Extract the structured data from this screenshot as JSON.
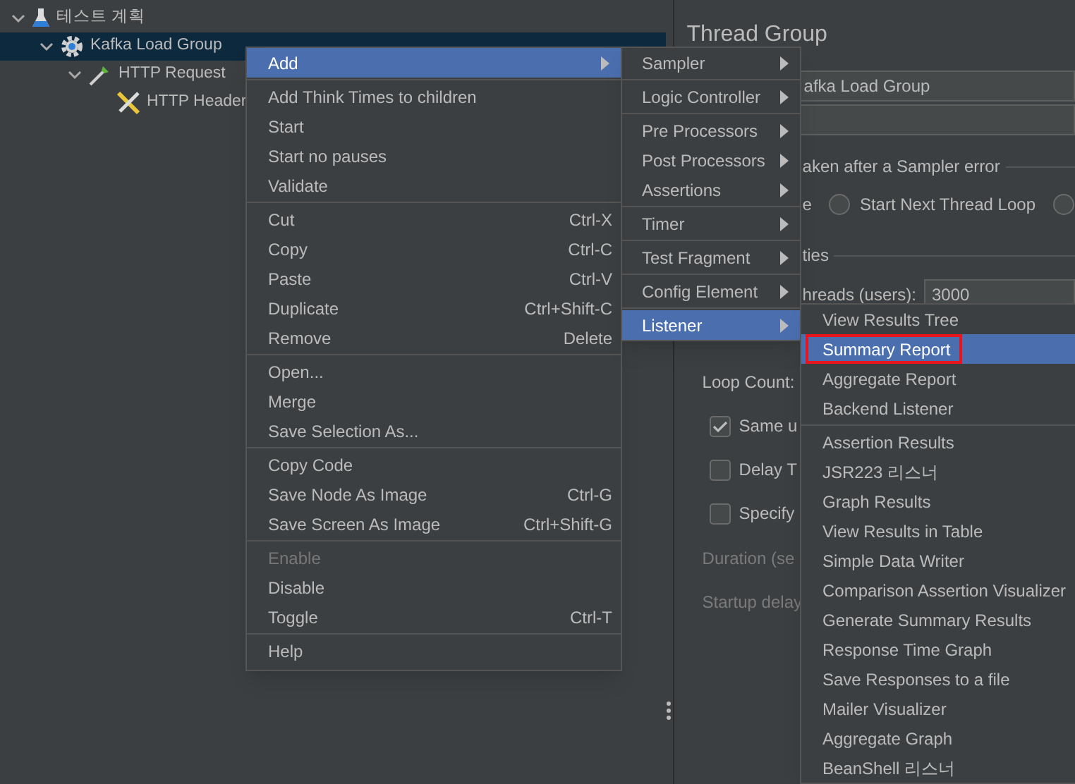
{
  "tree": {
    "items": [
      {
        "label": "테스트 계획",
        "expanded": true,
        "selected": false,
        "kind": "flask",
        "children": [
          {
            "label": "Kafka Load Group",
            "expanded": true,
            "selected": true,
            "kind": "gear",
            "children": [
              {
                "label": "HTTP Request",
                "expanded": true,
                "selected": false,
                "kind": "dropper",
                "children": [
                  {
                    "label": "HTTP Header",
                    "selected": false,
                    "kind": "tools"
                  }
                ]
              }
            ]
          }
        ]
      }
    ]
  },
  "panel": {
    "title": "Thread Group",
    "name_value": "afka Load Group",
    "error_legend": "aken after a Sampler error",
    "error_fragment": "e",
    "error_options": [
      {
        "label": "Start Next Thread Loop",
        "selected": false
      },
      {
        "selected": false
      }
    ],
    "properties_legend": "ties",
    "threads_label": "hreads (users):",
    "threads_value": "3000",
    "loop_label": "Loop Count:",
    "checks": [
      {
        "label": "Same u",
        "checked": true
      },
      {
        "label": "Delay T",
        "checked": false
      },
      {
        "label": "Specify",
        "checked": false
      }
    ],
    "disabled_labels": [
      "Duration (se",
      "Startup delay"
    ]
  },
  "context_menu": {
    "groups": [
      [
        {
          "label": "Add",
          "selected": true,
          "disabled": false,
          "submenu": true
        }
      ],
      [
        {
          "label": "Add Think Times to children",
          "selected": false,
          "disabled": false,
          "submenu": false
        },
        {
          "label": "Start",
          "selected": false,
          "disabled": false,
          "submenu": false
        },
        {
          "label": "Start no pauses",
          "selected": false,
          "disabled": false,
          "submenu": false
        },
        {
          "label": "Validate",
          "selected": false,
          "disabled": false,
          "submenu": false
        }
      ],
      [
        {
          "label": "Cut",
          "shortcut": "Ctrl-X",
          "selected": false,
          "disabled": false,
          "submenu": false
        },
        {
          "label": "Copy",
          "shortcut": "Ctrl-C",
          "selected": false,
          "disabled": false,
          "submenu": false
        },
        {
          "label": "Paste",
          "shortcut": "Ctrl-V",
          "selected": false,
          "disabled": false,
          "submenu": false
        },
        {
          "label": "Duplicate",
          "shortcut": "Ctrl+Shift-C",
          "selected": false,
          "disabled": false,
          "submenu": false
        },
        {
          "label": "Remove",
          "shortcut": "Delete",
          "selected": false,
          "disabled": false,
          "submenu": false
        }
      ],
      [
        {
          "label": "Open...",
          "selected": false,
          "disabled": false,
          "submenu": false
        },
        {
          "label": "Merge",
          "selected": false,
          "disabled": false,
          "submenu": false
        },
        {
          "label": "Save Selection As...",
          "selected": false,
          "disabled": false,
          "submenu": false
        }
      ],
      [
        {
          "label": "Copy Code",
          "selected": false,
          "disabled": false,
          "submenu": false
        },
        {
          "label": "Save Node As Image",
          "shortcut": "Ctrl-G",
          "selected": false,
          "disabled": false,
          "submenu": false
        },
        {
          "label": "Save Screen As Image",
          "shortcut": "Ctrl+Shift-G",
          "selected": false,
          "disabled": false,
          "submenu": false
        }
      ],
      [
        {
          "label": "Enable",
          "selected": false,
          "disabled": true,
          "submenu": false
        },
        {
          "label": "Disable",
          "selected": false,
          "disabled": false,
          "submenu": false
        },
        {
          "label": "Toggle",
          "shortcut": "Ctrl-T",
          "selected": false,
          "disabled": false,
          "submenu": false
        }
      ],
      [
        {
          "label": "Help",
          "selected": false,
          "disabled": false,
          "submenu": false
        }
      ]
    ]
  },
  "add_menu": {
    "groups": [
      [
        {
          "label": "Sampler",
          "selected": false
        }
      ],
      [
        {
          "label": "Logic Controller",
          "selected": false
        }
      ],
      [
        {
          "label": "Pre Processors",
          "selected": false
        },
        {
          "label": "Post Processors",
          "selected": false
        },
        {
          "label": "Assertions",
          "selected": false
        }
      ],
      [
        {
          "label": "Timer",
          "selected": false
        }
      ],
      [
        {
          "label": "Test Fragment",
          "selected": false
        }
      ],
      [
        {
          "label": "Config Element",
          "selected": false
        }
      ],
      [
        {
          "label": "Listener",
          "selected": true
        }
      ]
    ]
  },
  "listener_menu": {
    "groups": [
      [
        {
          "label": "View Results Tree",
          "selected": false,
          "outlined": false
        },
        {
          "label": "Summary Report",
          "selected": true,
          "outlined": true
        },
        {
          "label": "Aggregate Report",
          "selected": false,
          "outlined": false
        },
        {
          "label": "Backend Listener",
          "selected": false,
          "outlined": false
        }
      ],
      [
        {
          "label": "Assertion Results",
          "selected": false,
          "outlined": false
        },
        {
          "label": "JSR223 리스너",
          "selected": false,
          "outlined": false
        },
        {
          "label": "Graph Results",
          "selected": false,
          "outlined": false
        },
        {
          "label": "View Results in Table",
          "selected": false,
          "outlined": false
        },
        {
          "label": "Simple Data Writer",
          "selected": false,
          "outlined": false
        },
        {
          "label": "Comparison Assertion Visualizer",
          "selected": false,
          "outlined": false
        },
        {
          "label": "Generate Summary Results",
          "selected": false,
          "outlined": false
        },
        {
          "label": "Response Time Graph",
          "selected": false,
          "outlined": false
        },
        {
          "label": "Save Responses to a file",
          "selected": false,
          "outlined": false
        },
        {
          "label": "Mailer Visualizer",
          "selected": false,
          "outlined": false
        },
        {
          "label": "Aggregate Graph",
          "selected": false,
          "outlined": false
        },
        {
          "label": "BeanShell 리스너",
          "selected": false,
          "outlined": false
        }
      ]
    ]
  }
}
